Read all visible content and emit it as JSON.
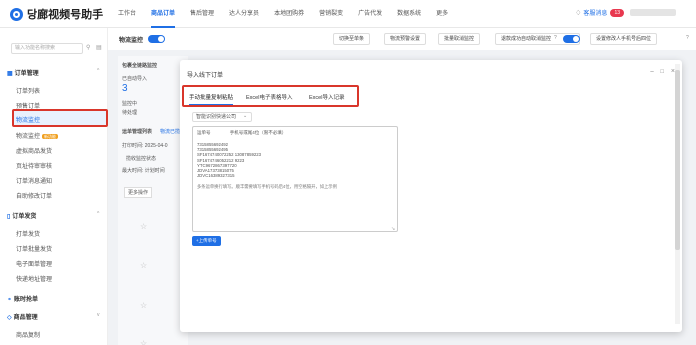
{
  "app": {
    "name": "당廊视频号助手"
  },
  "nav": {
    "items": [
      "工作台",
      "商品订单",
      "售后管理",
      "达人分享员",
      "本地团购券",
      "营销裂变",
      "广告代发",
      "数据系统",
      "更多"
    ],
    "active_index": 1
  },
  "topright": {
    "messages_label": "客服消息",
    "messages_count": "13"
  },
  "sidebar": {
    "search_placeholder": "输入功能名称搜索",
    "groups": [
      {
        "label": "订单管理",
        "items": [
          "订单列表",
          "预售订单",
          "物流监控",
          "物流监控",
          "虚拟商品发货",
          "页址待审审核",
          "订单消息通知",
          "自助修改订单"
        ]
      },
      {
        "label": "订单发货",
        "items": [
          "打单发货",
          "订单批量发货",
          "电子面单管理",
          "快递地址管理"
        ]
      },
      {
        "label": "账时抢单",
        "items": []
      },
      {
        "label": "商品管理",
        "items": [
          "商品复制"
        ]
      }
    ],
    "new_badge": "新功能",
    "active_item": "物流监控"
  },
  "main": {
    "title": "物流监控",
    "toolbar": [
      "切换至单条",
      "物流预警设置",
      "批量取消监控",
      "退款成功自动取消监控",
      "设置修改人手机号后四位"
    ],
    "help_mark": "?",
    "panel_lines": [
      "包裹全链路监控",
      "已自动导入",
      "3",
      "监控中",
      "待处理",
      "运单管理列表",
      "物流已揽件",
      "打印时间: 2025-04-0",
      "揽收监控状态",
      "最大时间: 计划时间",
      "更多操作"
    ]
  },
  "modal": {
    "title": "导入线下订单",
    "tabs": [
      "手动批量复制粘贴",
      "Excel电子表格导入",
      "Excel导入记录"
    ],
    "active_tab": 0,
    "courier_select": "智能识别快递公司",
    "textarea": {
      "header": [
        "运单号",
        "手机号或尾4位（限不必填）"
      ],
      "lines": [
        "7315855692492",
        "7315855692495",
        "SF1674740072252 13087859223",
        "SF1674746052212 9223",
        "YTC9672867397720",
        "JDVA17373815075",
        "JDVC16389327315"
      ],
      "note": "多条运单换行填写。顺丰需要填写手机号码后4位，用空格隔开，如上示例"
    },
    "upload_label": "+上传单号",
    "window_controls": [
      "−",
      "□",
      "×"
    ]
  }
}
